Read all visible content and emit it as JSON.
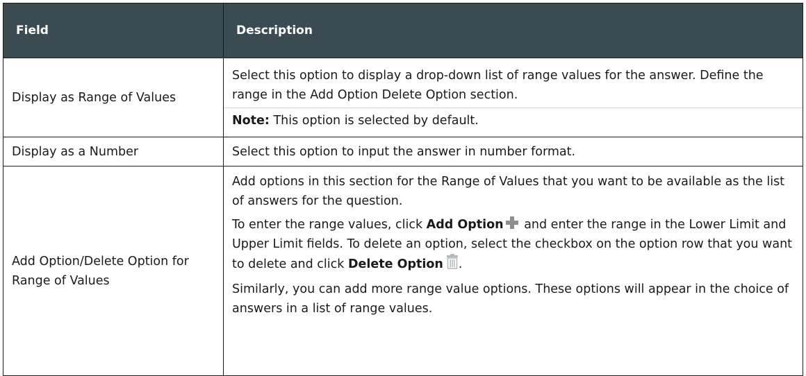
{
  "header": {
    "field": "Field",
    "description": "Description"
  },
  "rows": [
    {
      "field": "Display as Range of Values",
      "desc_p1": "Select this option to display a drop-down list of range values for the answer. Define the range in the Add Option Delete Option section.",
      "note_label": "Note:",
      "note_text": " This option is selected by default."
    },
    {
      "field": "Display as a Number",
      "desc_p1": "Select this option to input the answer in number format."
    },
    {
      "field": "Add Option/Delete Option for Range of Values",
      "desc_p1": "Add options in this section for the Range of Values that you want to be available as the list of answers for the question.",
      "desc_p2_a": "To enter the range values, click ",
      "desc_p2_b": "Add Option",
      "desc_p2_c": " and enter the range in the Lower Limit and Upper Limit fields. To delete an option, select the checkbox on the option row that you want to delete and click ",
      "desc_p2_d": "Delete Option",
      "desc_p2_e": ".",
      "desc_p3": "Similarly, you can add more range value options. These options will appear in the choice of answers in a list of range values.",
      "icons": [
        "plus-icon",
        "trash-icon"
      ]
    }
  ]
}
